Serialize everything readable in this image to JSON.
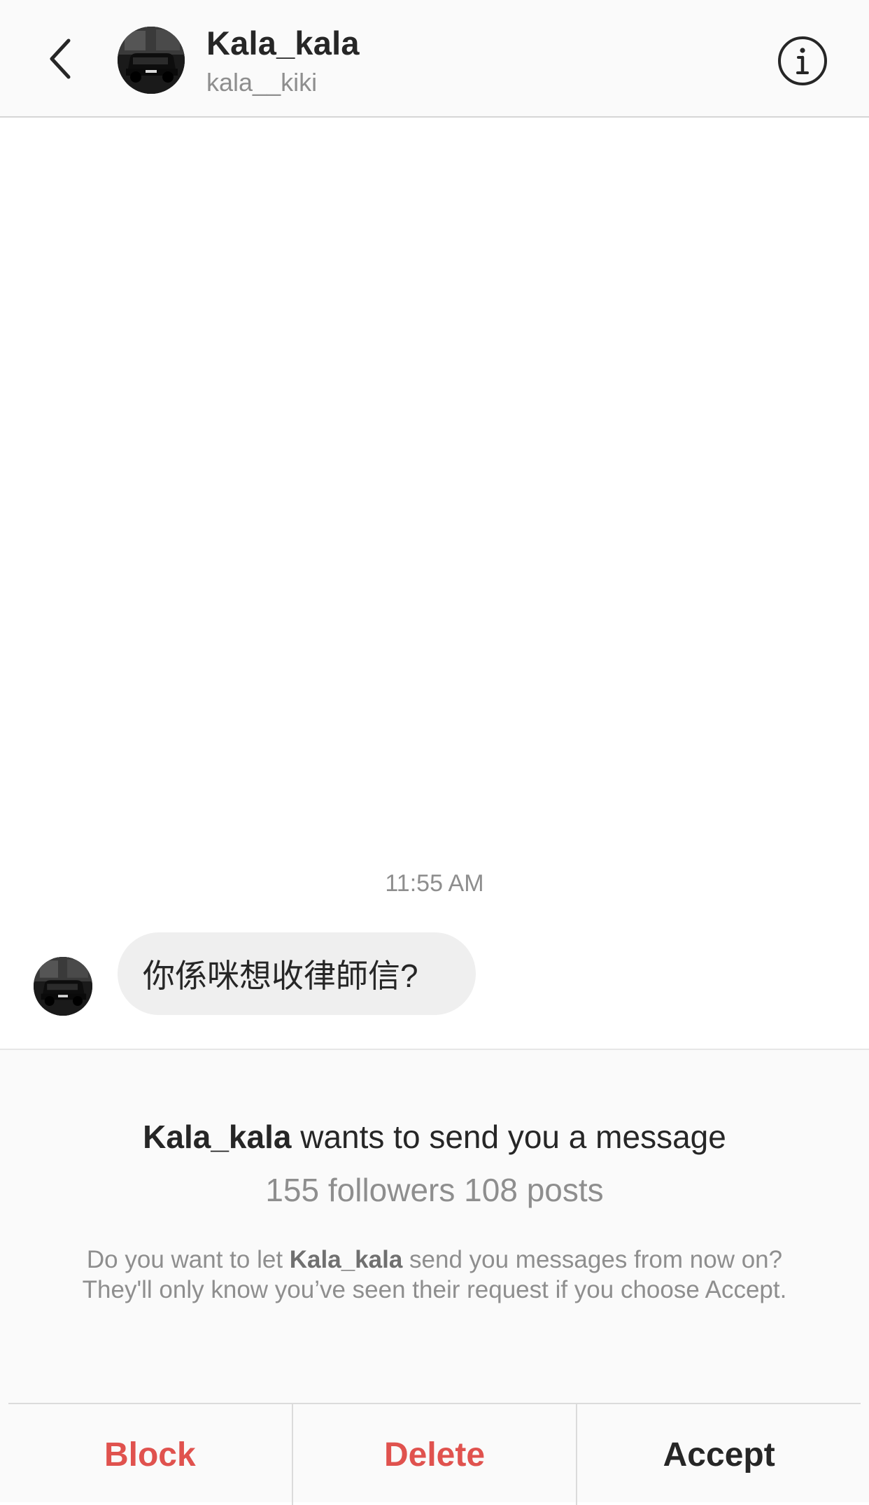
{
  "header": {
    "title": "Kala_kala",
    "subtitle": "kala__kiki",
    "back_icon": "chevron-left-icon",
    "info_icon": "info-circle-icon"
  },
  "thread": {
    "timestamp": "11:55 AM",
    "messages": [
      {
        "sender": "Kala_kala",
        "text": "你係咪想收律師信?"
      }
    ]
  },
  "request": {
    "sender_name": "Kala_kala",
    "title_suffix": " wants to send you a message",
    "stats": "155 followers 108 posts",
    "body_prefix": "Do you want to let ",
    "body_name": "Kala_kala",
    "body_suffix": " send you messages from now on? They'll only know you’ve seen their request if you choose Accept."
  },
  "actions": {
    "block": "Block",
    "delete": "Delete",
    "accept": "Accept"
  },
  "colors": {
    "danger": "#e0524e",
    "primary_text": "#262626",
    "secondary_text": "#8e8e8e",
    "bubble_bg": "#efefef",
    "panel_bg": "#fafafa"
  }
}
